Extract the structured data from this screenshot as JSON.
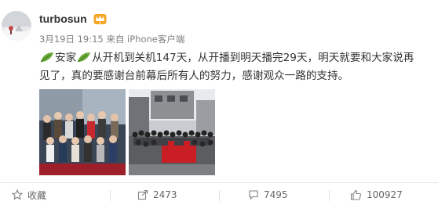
{
  "post": {
    "username": "turbosun",
    "date": "3月19日 19:15",
    "source": "来自 iPhone客户端",
    "text_parts": [
      "安家",
      "从开机到关机147天，从开播到明天播完29天，明天就要和大家说再见了，真的要感谢台前幕后所有人的努力，感谢观众一路的支持。"
    ],
    "photos": [
      "photo-cast-group",
      "photo-wrap-party-group"
    ]
  },
  "actions": {
    "favorite_label": "收藏",
    "share_count": "2473",
    "comment_count": "7495",
    "like_count": "100927"
  },
  "colors": {
    "text": "#333333",
    "meta": "#808080",
    "action_text": "#666666",
    "badge": "#f6a623",
    "leaf": "#6cab3a"
  },
  "icons": {
    "badge": "crown-badge-icon",
    "emoji": "leaf-emoji-icon",
    "favorite": "star-icon",
    "share": "share-icon",
    "comment": "comment-icon",
    "like": "thumbs-up-icon"
  }
}
